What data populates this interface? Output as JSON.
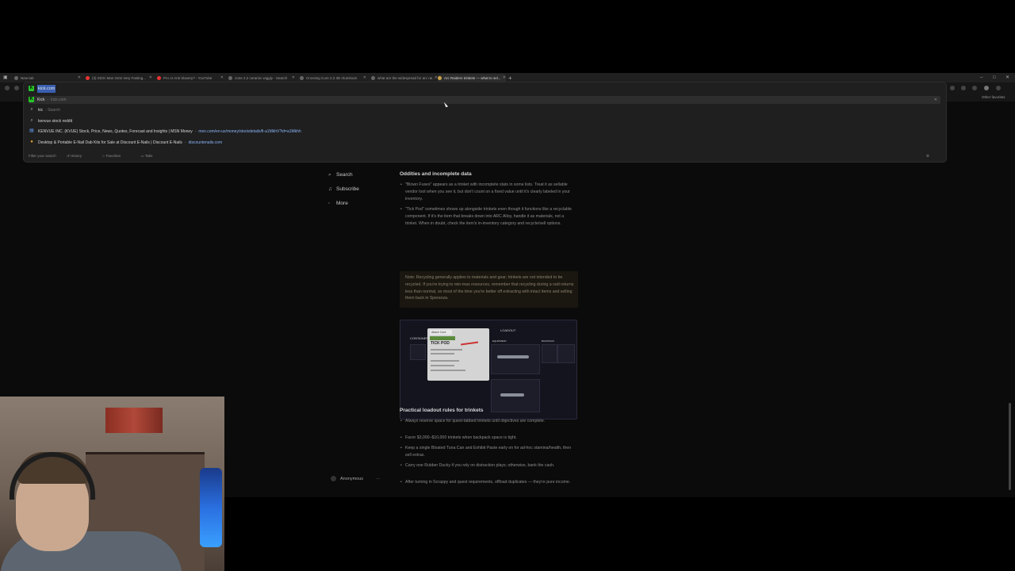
{
  "browser": {
    "tabs": [
      {
        "label": "New tab"
      },
      {
        "label": "(3) SICK Man Gets Very Fasting..."
      },
      {
        "label": "Pro or Anti Slavery? - YouTube"
      },
      {
        "label": "zone 2.2 ceramic wiggly - Search"
      },
      {
        "label": "Crossing Cure 2.2 3D Aluminum"
      },
      {
        "label": "what are the widespread for arc rai..."
      },
      {
        "label": "Arc Raiders trinkets — what to sel..."
      }
    ],
    "new_tab_symbol": "+",
    "other_favorites": "Other favorites"
  },
  "omnibox": {
    "input_value": "kick.com",
    "suggestions": [
      {
        "label": "Kick",
        "sub": "kick.com",
        "icon": "kick-logo-icon"
      },
      {
        "label": "kic",
        "dim": "- Search",
        "icon": "search-icon"
      },
      {
        "label": "kenvue stock reddit",
        "icon": "search-icon"
      },
      {
        "label": "KENVUE INC. (KVUE) Stock, Price, News, Quotes, Forecast and Insights | MSN Money",
        "sub": "msn.com/en-us/money/stockdetails/fi-a1MkhV?id=a1Mkhh",
        "icon": "msn-icon"
      },
      {
        "label": "Desktop & Portable E-Nail Dab Kits for Sale at Discount E-Nails | Discount E-Nails",
        "sub": "discountenails.com",
        "icon": "site-icon"
      }
    ],
    "footer": {
      "filter_label": "Filter your search",
      "history": "History",
      "favorites": "Favorites",
      "tabs": "Tabs"
    }
  },
  "sidebar": {
    "items": [
      {
        "label": "Search",
        "icon": "search-icon"
      },
      {
        "label": "Subscribe",
        "icon": "bell-icon"
      },
      {
        "label": "More",
        "icon": "more-icon"
      }
    ],
    "user": "Anonymous",
    "user_menu": "···"
  },
  "article": {
    "section1_title": "Oddities and incomplete data",
    "bullets1": [
      "\"Blown Fuses\" appears as a trinket with incomplete stats in some lists. Treat it as sellable vendor loot when you see it, but don't count on a fixed value until it's clearly labeled in your inventory.",
      "\"Tick Pod\" sometimes shows up alongside trinkets even though it functions like a recyclable component. If it's the item that breaks down into ARC Alloy, handle it as materials, not a trinket. When in doubt, check the item's in-inventory category and recycle/sell options."
    ],
    "note": "Note: Recycling generally applies to materials and gear; trinkets are not intended to be recycled. If you're trying to min-max resources, remember that recycling during a raid returns less than normal, so most of the time you're better off extracting with intact items and selling them back in Speranza.",
    "image": {
      "containers": "CONTAINERS",
      "card_tag": "Attach Cont",
      "card_title": "TICK POD",
      "loadout": "LOADOUT",
      "equipment": "EQUIPMENT",
      "backpack": "BACKPACK"
    },
    "section2_title": "Practical loadout rules for trinkets",
    "bullets2": [
      "Always reserve space for quest-tabbed trinkets until objectives are complete.",
      "Favor $3,000–$10,000 trinkets when backpack space is tight.",
      "Keep a single Bloated Tuna Can and Exhibit Paste early on for ad-hoc stamina/health, then sell extras.",
      "Carry one Rubber Ducky if you rely on distraction plays; otherwise, bank the cash.",
      "After turning in Scrappy and quest requirements, offload duplicates — they're pure income."
    ]
  },
  "colors": {
    "kick_green": "#27c42a",
    "selection_blue": "#3a5fb0",
    "link_blue": "#8ab4f8"
  }
}
